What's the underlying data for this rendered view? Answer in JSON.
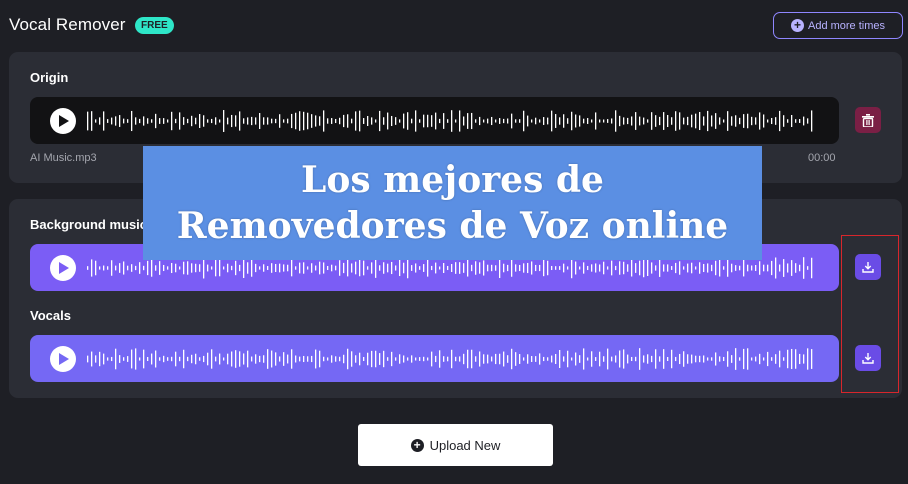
{
  "header": {
    "title": "Vocal Remover",
    "badge": "FREE",
    "add_more_label": "Add more times"
  },
  "origin": {
    "label": "Origin",
    "file_name": "AI Music.mp3",
    "duration": "00:00"
  },
  "results": {
    "background_label": "Background music",
    "vocals_label": "Vocals"
  },
  "overlay": {
    "line1": "Los mejores de",
    "line2": "Removedores de Voz online"
  },
  "upload_label": "Upload New",
  "colors": {
    "accent": "#7b5df5",
    "badge": "#2ee6c8",
    "delete": "#7a1f45",
    "highlight": "#d8262c",
    "overlay": "#5b8fe3"
  },
  "icons": [
    "plus-circle-icon",
    "play-icon",
    "trash-icon",
    "download-icon"
  ]
}
